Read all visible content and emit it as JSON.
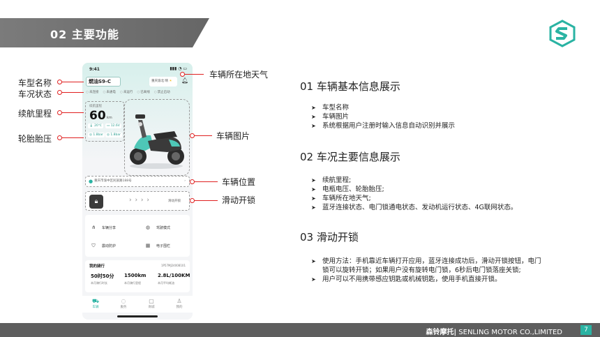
{
  "header": {
    "title": "02 主要功能"
  },
  "footer": {
    "brand_cn": "森铃摩托|",
    "brand_en": " SENLING MOTOR CO.,LIMITED",
    "page": "7"
  },
  "phone": {
    "time": "9:41",
    "model": "燃油S9-C",
    "weather": "重庆渝北 晴",
    "status_items": [
      "未连接",
      "未通电",
      "未运行",
      "已离线",
      "禁止启动"
    ],
    "range_label": "续航里程",
    "range_value": "60",
    "range_unit": "km",
    "temp": "20℃",
    "voltage": "12.6V",
    "tire_front": "1.8bar",
    "tire_rear": "1.8bar",
    "location": "重庆市渝中区民族路188号",
    "slide_text": "滑动开锁",
    "functions": [
      "车辆分享",
      "驾驶模式",
      "震动防护",
      "电子围栏"
    ],
    "ride_title": "我的骑行",
    "ride_id": "1P57MJ24008101",
    "ride_stats": [
      {
        "value": "50时50分",
        "label": "本月骑行时长"
      },
      {
        "value": "1500km",
        "label": "本月骑行里程"
      },
      {
        "value": "2.8L/100KM",
        "label": "本月平均耗油"
      }
    ],
    "tabs": [
      "车辆",
      "服务",
      "商城",
      "我的"
    ]
  },
  "callouts": {
    "model_name": "车型名称",
    "vehicle_status": "车况状态",
    "range": "续航里程",
    "tire_pressure": "轮胎胎压",
    "weather": "车辆所在地天气",
    "vehicle_image": "车辆图片",
    "vehicle_location": "车辆位置",
    "slide_unlock": "滑动开锁"
  },
  "sections": [
    {
      "title": "01 车辆基本信息展示",
      "items": [
        "车型名称",
        "车辆图片",
        "系统根据用户注册时输入信息自动识别并展示"
      ]
    },
    {
      "title": "02 车况主要信息展示",
      "items": [
        "续航里程;",
        "电瓶电压、轮胎胎压;",
        "车辆所在地天气;",
        "蓝牙连接状态、电门锁通电状态、发动机运行状态、4G联网状态。"
      ]
    },
    {
      "title": "03 滑动开锁",
      "items": [
        "使用方法：手机靠近车辆打开应用，蓝牙连接成功后，滑动开锁按钮，电门锁可以旋转开锁；如果用户没有旋转电门锁，6秒后电门锁落座关锁;",
        "用户可以不用携带感应钥匙或机械钥匙，使用手机直接开锁。"
      ]
    }
  ],
  "colors": {
    "accent": "#2ab3a3",
    "callout_red": "#e02020",
    "header_gray": "#6e6e6e"
  }
}
